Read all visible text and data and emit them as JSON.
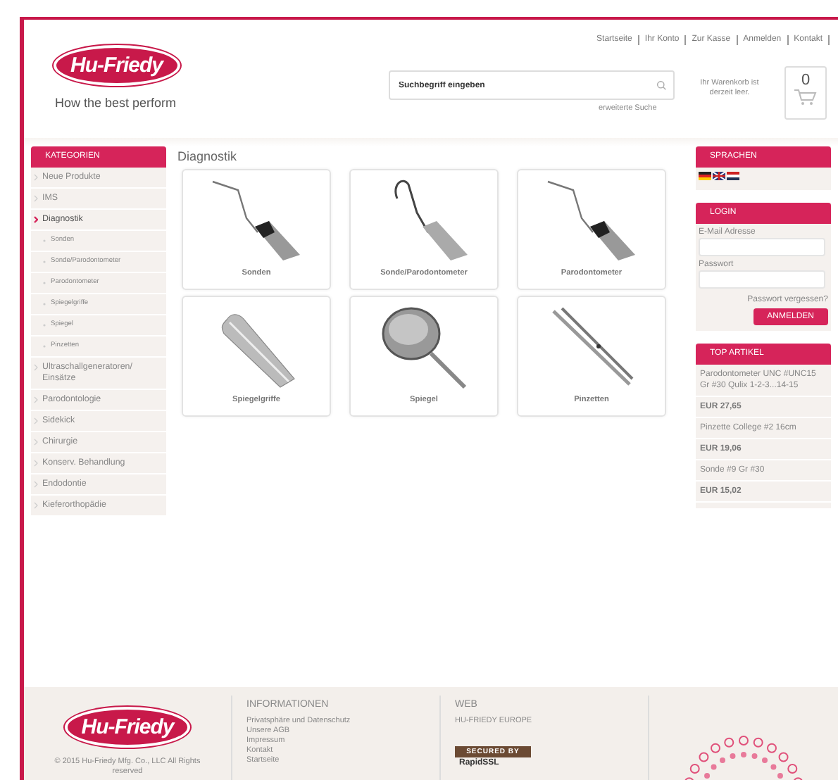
{
  "header": {
    "logo": "Hu-Friedy",
    "tagline": "How the best perform",
    "top_links": [
      "Startseite",
      "Ihr Konto",
      "Zur Kasse",
      "Anmelden",
      "Kontakt"
    ],
    "search": {
      "placeholder": "Suchbegriff eingeben"
    },
    "advanced_search": "erweiterte Suche",
    "cart": {
      "text": "Ihr Warenkorb ist derzeit leer.",
      "count": "0"
    }
  },
  "categories": {
    "title": "KATEGORIEN",
    "items": [
      {
        "label": "Neue Produkte",
        "kind": "category",
        "selected": false
      },
      {
        "label": "IMS",
        "kind": "category",
        "selected": false
      },
      {
        "label": "Diagnostik",
        "kind": "category",
        "selected": true
      },
      {
        "label": "Sonden",
        "kind": "subcategory",
        "selected": false
      },
      {
        "label": "Sonde/Parodontometer",
        "kind": "subcategory",
        "selected": false
      },
      {
        "label": "Parodontometer",
        "kind": "subcategory",
        "selected": false
      },
      {
        "label": "Spiegelgriffe",
        "kind": "subcategory",
        "selected": false
      },
      {
        "label": "Spiegel",
        "kind": "subcategory",
        "selected": false
      },
      {
        "label": "Pinzetten",
        "kind": "subcategory",
        "selected": false
      },
      {
        "label": "Ultraschallgeneratoren/ Einsätze",
        "kind": "category",
        "selected": false
      },
      {
        "label": "Parodontologie",
        "kind": "category",
        "selected": false
      },
      {
        "label": "Sidekick",
        "kind": "category",
        "selected": false
      },
      {
        "label": "Chirurgie",
        "kind": "category",
        "selected": false
      },
      {
        "label": "Konserv. Behandlung",
        "kind": "category",
        "selected": false
      },
      {
        "label": "Endodontie",
        "kind": "category",
        "selected": false
      },
      {
        "label": "Kieferorthopädie",
        "kind": "category",
        "selected": false
      }
    ]
  },
  "content": {
    "title": "Diagnostik",
    "products": [
      {
        "label": "Sonden",
        "kind": "probe"
      },
      {
        "label": "Sonde/Parodontometer",
        "kind": "hook"
      },
      {
        "label": "Parodontometer",
        "kind": "probe"
      },
      {
        "label": "Spiegelgriffe",
        "kind": "handle"
      },
      {
        "label": "Spiegel",
        "kind": "mirror"
      },
      {
        "label": "Pinzetten",
        "kind": "tweezers"
      }
    ]
  },
  "languages": {
    "title": "SPRACHEN",
    "flags": [
      {
        "kind": "de"
      },
      {
        "kind": "gb"
      },
      {
        "kind": "nl"
      }
    ]
  },
  "login": {
    "title": "LOGIN",
    "email_label": "E-Mail Adresse",
    "password_label": "Passwort",
    "forgot": "Passwort vergessen?",
    "button": "ANMELDEN"
  },
  "top_articles": {
    "title": "TOP ARTIKEL",
    "items": [
      {
        "name": "Parodontometer UNC #UNC15 Gr #30 Qulix 1-2-3...14-15",
        "price": "EUR 27,65"
      },
      {
        "name": "Pinzette College #2 16cm",
        "price": "EUR 19,06"
      },
      {
        "name": "Sonde #9 Gr #30",
        "price": "EUR 15,02"
      }
    ]
  },
  "footer": {
    "logo": "Hu-Friedy",
    "copyright": "© 2015 Hu-Friedy Mfg. Co., LLC All Rights reserved",
    "info_title": "INFORMATIONEN",
    "info_links": [
      "Privatsphäre und Datenschutz",
      "Unsere AGB",
      "Impressum",
      "Kontakt",
      "Startseite"
    ],
    "web_title": "WEB",
    "web_links": [
      "HU-FRIEDY EUROPE"
    ],
    "badge_top": "SECURED BY",
    "badge_bottom": "RapidSSL"
  }
}
